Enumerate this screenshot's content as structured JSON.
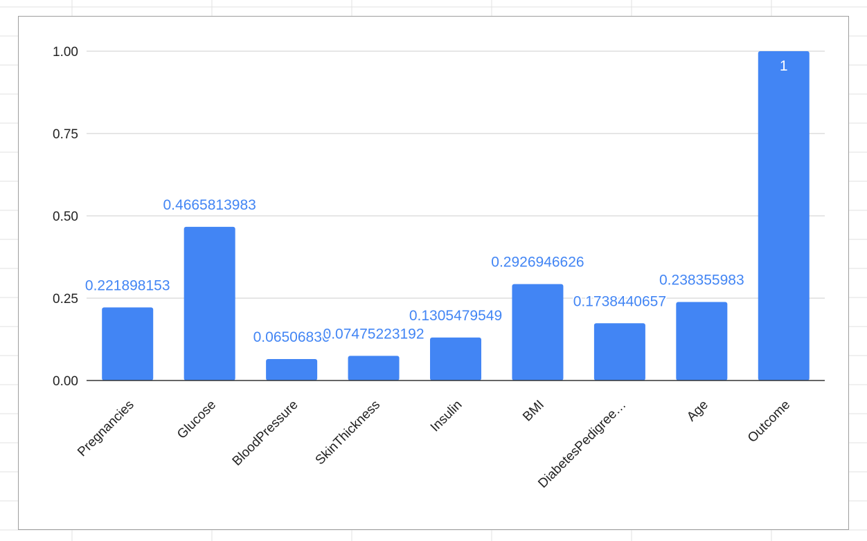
{
  "chart_data": {
    "type": "bar",
    "categories": [
      "Pregnancies",
      "Glucose",
      "BloodPressure",
      "SkinThickness",
      "Insulin",
      "BMI",
      "DiabetesPedigree…",
      "Age",
      "Outcome"
    ],
    "values": [
      0.221898153,
      0.4665813983,
      0.0650683,
      0.07475223192,
      0.1305479549,
      0.2926946626,
      0.1738440657,
      0.238355983,
      1
    ],
    "data_labels": [
      "0.221898153",
      "0.4665813983",
      "0.06506830",
      "0.07475223192",
      "0.1305479549",
      "0.2926946626",
      "0.1738440657",
      "0.238355983",
      "1"
    ],
    "title": "",
    "xlabel": "",
    "ylabel": "",
    "ylim": [
      0,
      1
    ],
    "y_ticks": [
      "0.00",
      "0.25",
      "0.50",
      "0.75",
      "1.00"
    ],
    "grid": true,
    "legend": "none"
  },
  "colors": {
    "bar": "#4285f4",
    "data_label": "#4285f4",
    "data_label_inside": "#ffffff",
    "gridline": "#cccccc",
    "baseline": "#333333",
    "sheet_grid": "#e2e2e2"
  }
}
